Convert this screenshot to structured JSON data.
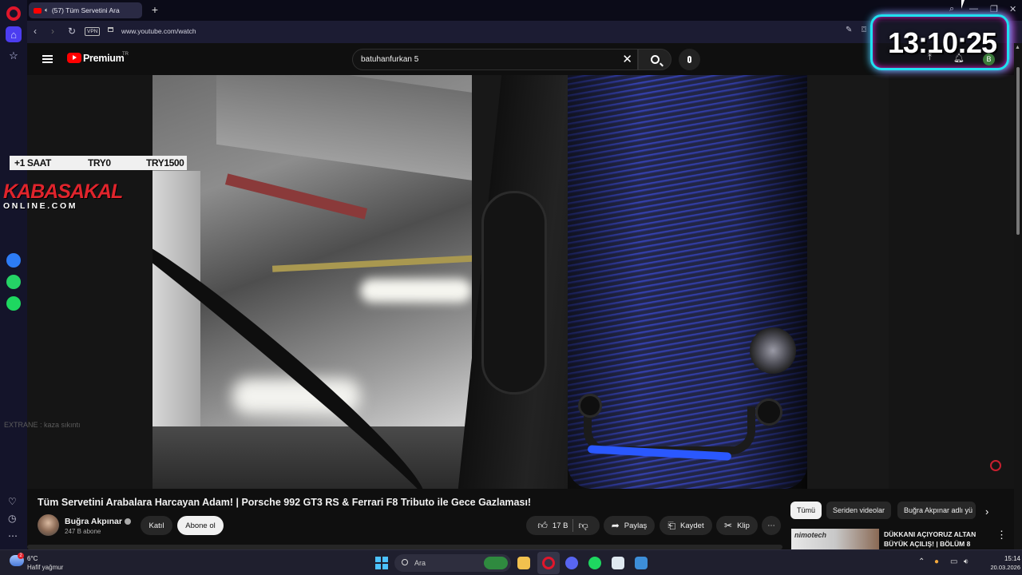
{
  "browser": {
    "tab_title": "(57) Tüm Servetini Ara",
    "url": "www.youtube.com/watch",
    "vpn_label": "VPN",
    "new_tab_label": "+",
    "accent_color": "#e0162b"
  },
  "youtube": {
    "brand": "Premium",
    "country_code": "TR",
    "search_value": "batuhanfurkan 5",
    "video": {
      "title": "Tüm Servetini Arabalara Harcayan Adam! | Porsche 992 GT3 RS & Ferrari F8 Tributo ile Gece Gazlaması!",
      "channel_name": "Buğra Akpınar",
      "subscribers": "247 B abone",
      "join_label": "Katıl",
      "subscribe_label": "Abone ol",
      "likes": "17 B",
      "share_label": "Paylaş",
      "save_label": "Kaydet",
      "clip_label": "Klip"
    },
    "chips": [
      "Tümü",
      "Seriden videolar",
      "Buğra Akpınar adlı yü"
    ],
    "recommended": {
      "thumb_text": "nimotech",
      "title": "DÜKKANI AÇIYORUZ ALTAN BÜYÜK AÇILIŞ! | BÖLÜM 8"
    }
  },
  "overlays": {
    "promo": [
      "+1 SAAT",
      "TRY0",
      "TRY1500"
    ],
    "logo_main": "KABASAKAL",
    "logo_sub": "ONLINE.COM",
    "extra_text": "EXTRANE : kaza sıkıntı",
    "clock": "13:10:25",
    "avatar_letter": "B"
  },
  "taskbar": {
    "weather_temp": "6°C",
    "weather_desc": "Hafif yağmur",
    "weather_badge": "2",
    "search_placeholder": "Ara",
    "time": "15:14",
    "date": "20.03.2026"
  }
}
